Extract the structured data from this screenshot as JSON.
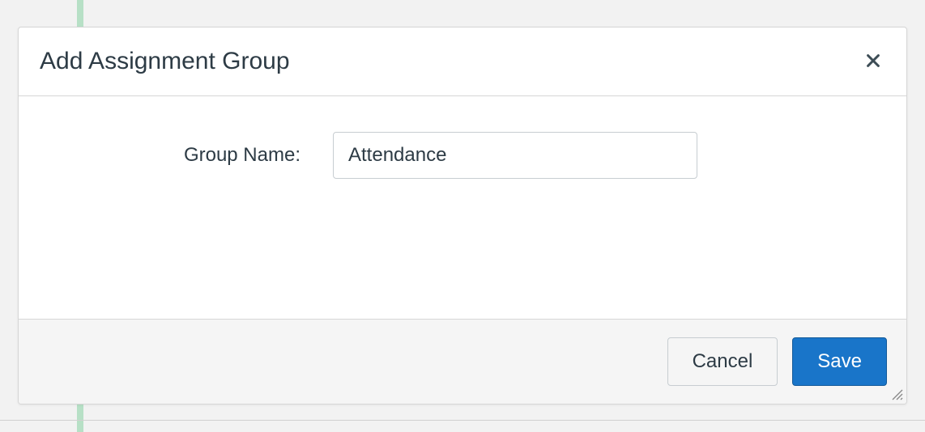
{
  "modal": {
    "title": "Add Assignment Group",
    "form": {
      "group_name_label": "Group Name:",
      "group_name_value": "Attendance"
    },
    "footer": {
      "cancel_label": "Cancel",
      "save_label": "Save"
    }
  }
}
